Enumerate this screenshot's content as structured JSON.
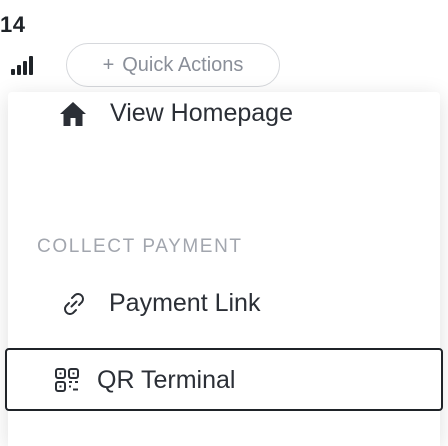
{
  "status_bar": {
    "time": "14",
    "signal_icon": "cellular-signal-icon"
  },
  "quick_actions": {
    "plus_glyph": "+",
    "label": "Quick Actions"
  },
  "menu": {
    "home": {
      "icon": "home-icon",
      "label": "View Homepage"
    },
    "section_heading": "COLLECT PAYMENT",
    "payment_link": {
      "icon": "link-icon",
      "label": "Payment Link"
    },
    "qr_terminal": {
      "icon": "qr-code-icon",
      "label": "QR Terminal"
    }
  },
  "colors": {
    "text_primary": "#2b2f36",
    "text_muted": "#a2a6ae",
    "border_light": "#d6d8dc",
    "border_selected": "#1f2328"
  }
}
